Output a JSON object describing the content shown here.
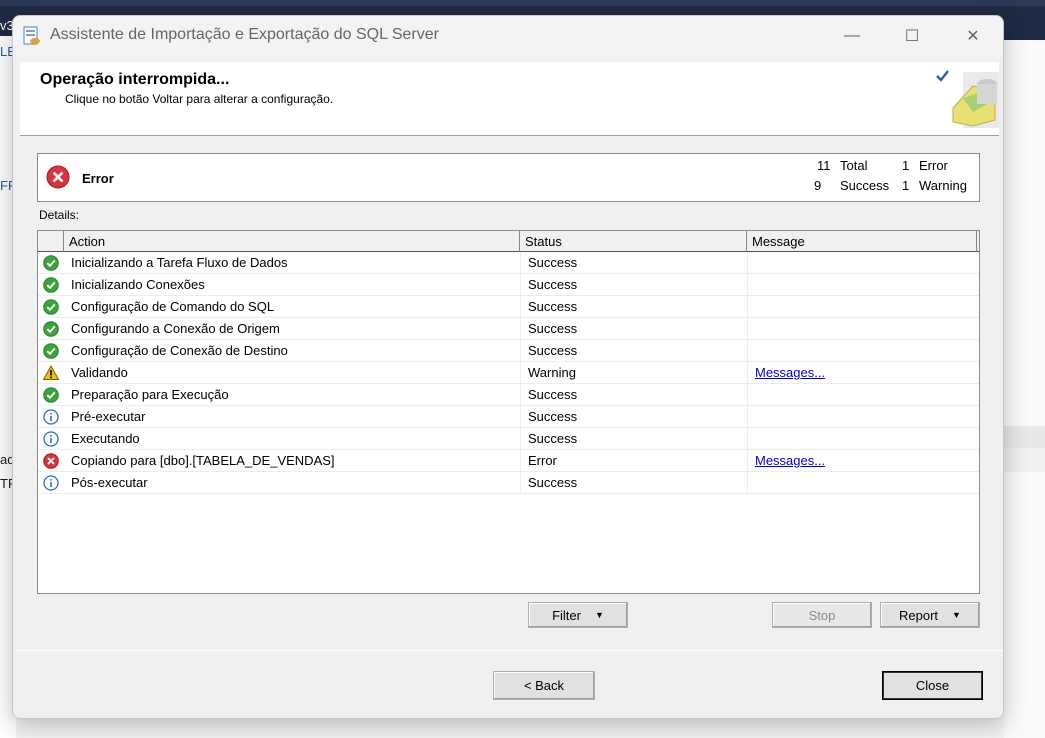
{
  "background": {
    "fragments": [
      "v3",
      "LE",
      "FR",
      "ad",
      "TF"
    ]
  },
  "window": {
    "title": "Assistente de Importação e Exportação do SQL Server",
    "minimize_glyph": "—",
    "maximize_glyph": "☐",
    "close_glyph": "✕"
  },
  "header": {
    "title": "Operação interrompida...",
    "subtitle": "Clique no botão Voltar para alterar a configuração."
  },
  "summary": {
    "status": "Error",
    "total_count": "11",
    "total_label": "Total",
    "success_count": "9",
    "success_label": "Success",
    "error_count": "1",
    "error_label": "Error",
    "warning_count": "1",
    "warning_label": "Warning"
  },
  "details_label": "Details:",
  "table": {
    "columns": [
      "Action",
      "Status",
      "Message"
    ],
    "rows": [
      {
        "icon": "success-icon",
        "action": "Inicializando a Tarefa Fluxo de Dados",
        "status": "Success",
        "message": ""
      },
      {
        "icon": "success-icon",
        "action": "Inicializando Conexões",
        "status": "Success",
        "message": ""
      },
      {
        "icon": "success-icon",
        "action": "Configuração de Comando do SQL",
        "status": "Success",
        "message": ""
      },
      {
        "icon": "success-icon",
        "action": "Configurando a Conexão de Origem",
        "status": "Success",
        "message": ""
      },
      {
        "icon": "success-icon",
        "action": "Configuração de Conexão de Destino",
        "status": "Success",
        "message": ""
      },
      {
        "icon": "warning-icon",
        "action": "Validando",
        "status": "Warning",
        "message": "Messages..."
      },
      {
        "icon": "success-icon",
        "action": "Preparação para Execução",
        "status": "Success",
        "message": ""
      },
      {
        "icon": "info-icon",
        "action": "Pré-executar",
        "status": "Success",
        "message": ""
      },
      {
        "icon": "info-icon",
        "action": "Executando",
        "status": "Success",
        "message": ""
      },
      {
        "icon": "error-icon",
        "action": "Copiando para [dbo].[TABELA_DE_VENDAS]",
        "status": "Error",
        "message": "Messages..."
      },
      {
        "icon": "info-icon",
        "action": "Pós-executar",
        "status": "Success",
        "message": ""
      }
    ]
  },
  "buttons": {
    "filter": "Filter",
    "stop": "Stop",
    "report": "Report",
    "back": "< Back",
    "close": "Close"
  },
  "colors": {
    "success": "#3aa63a",
    "warning": "#f2c200",
    "info": "#2a6dc9",
    "error": "#d8343c",
    "link": "#0000ee"
  }
}
